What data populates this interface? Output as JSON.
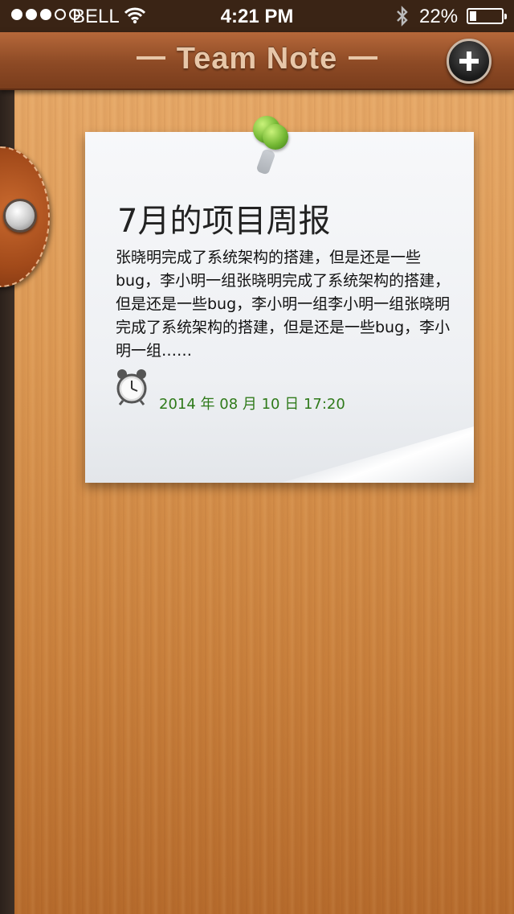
{
  "status_bar": {
    "carrier": "BELL",
    "signal_bars_filled": 3,
    "signal_bars_total": 5,
    "time": "4:21 PM",
    "battery_percent_label": "22%",
    "battery_level": 0.22,
    "icons": [
      "wifi-icon",
      "bluetooth-icon",
      "battery-icon"
    ]
  },
  "header": {
    "title": "Team Note",
    "add_button_icon": "plus-icon"
  },
  "note": {
    "title": "7月的项目周报",
    "body": "张晓明完成了系统架构的搭建，但是还是一些bug，李小明一组张晓明完成了系统架构的搭建，但是还是一些bug，李小明一组李小明一组张晓明完成了系统架构的搭建，但是还是一些bug，李小明一组……",
    "date": "2014 年 08 月 10 日 17:20",
    "date_icon": "alarm-clock-icon",
    "pin_icon": "pushpin-icon"
  },
  "colors": {
    "header": "#8d4a25",
    "title_text": "#e7c7a9",
    "date_text": "#2f7a1a",
    "pin": "#74b834"
  }
}
